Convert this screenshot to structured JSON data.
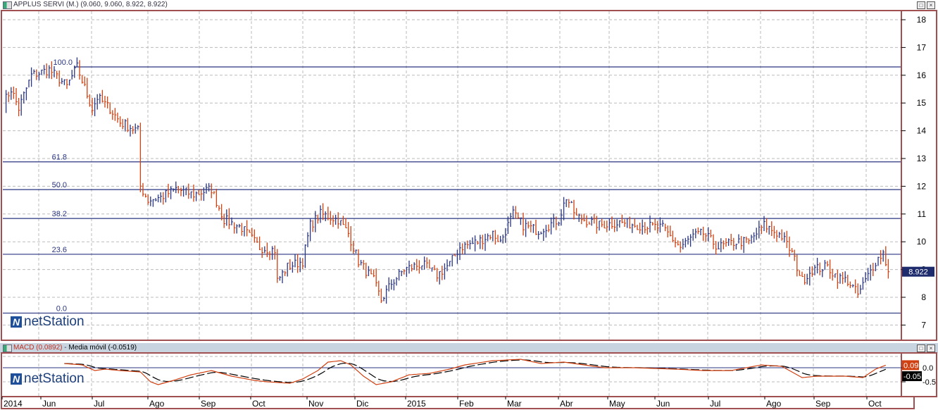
{
  "main_panel": {
    "title": "APPLUS SERVI (M.) (9.060, 9.060, 8.922, 8.922)",
    "last_price": "8.922",
    "logo": "netStation"
  },
  "macd_panel": {
    "macd_label": "MACD (0.0892)",
    "separator": "-",
    "signal_label": "Media móvil (-0.0519)",
    "macd_value": "0.09",
    "signal_value": "-0.05",
    "logo": "netStation"
  },
  "window_buttons": {
    "maximize": "□",
    "close": "×"
  },
  "chart_data": [
    {
      "type": "ohlc",
      "title": "APPLUS SERVI (M.)",
      "ylim": [
        7,
        18
      ],
      "y_ticks": [
        "18",
        "17",
        "16",
        "15",
        "14",
        "13",
        "12",
        "11",
        "10",
        "9",
        "8",
        "7"
      ],
      "x_ticks": [
        "2014",
        "Jun",
        "Jul",
        "Ago",
        "Sep",
        "Oct",
        "Nov",
        "Dic",
        "2015",
        "Feb",
        "Mar",
        "Abr",
        "May",
        "Jun",
        "Jul",
        "Ago",
        "Sep",
        "Oct"
      ],
      "fibonacci": [
        {
          "label": "100.0",
          "value": 16.3
        },
        {
          "label": "61.8",
          "value": 12.88
        },
        {
          "label": "50.0",
          "value": 11.88
        },
        {
          "label": "38.2",
          "value": 10.84
        },
        {
          "label": "23.6",
          "value": 9.55
        },
        {
          "label": "0.0",
          "value": 7.43
        }
      ],
      "close_anchors": [
        [
          0,
          15.0
        ],
        [
          3,
          15.5
        ],
        [
          6,
          14.8
        ],
        [
          11,
          16.0
        ],
        [
          18,
          16.2
        ],
        [
          25,
          15.6
        ],
        [
          29,
          16.3
        ],
        [
          35,
          14.8
        ],
        [
          37,
          15.2
        ],
        [
          42,
          14.8
        ],
        [
          46,
          14.3
        ],
        [
          53,
          14.0
        ],
        [
          54,
          12.0
        ],
        [
          57,
          11.5
        ],
        [
          62,
          11.6
        ],
        [
          68,
          11.9
        ],
        [
          75,
          11.7
        ],
        [
          82,
          11.9
        ],
        [
          87,
          10.8
        ],
        [
          94,
          10.5
        ],
        [
          101,
          9.8
        ],
        [
          107,
          9.7
        ],
        [
          108,
          8.6
        ],
        [
          112,
          9.1
        ],
        [
          118,
          9.3
        ],
        [
          121,
          10.6
        ],
        [
          125,
          11.0
        ],
        [
          132,
          10.8
        ],
        [
          136,
          10.3
        ],
        [
          140,
          9.3
        ],
        [
          146,
          8.6
        ],
        [
          149,
          7.9
        ],
        [
          153,
          8.5
        ],
        [
          158,
          9.0
        ],
        [
          165,
          9.2
        ],
        [
          171,
          8.8
        ],
        [
          176,
          9.2
        ],
        [
          180,
          9.8
        ],
        [
          187,
          10.0
        ],
        [
          193,
          10.3
        ],
        [
          196,
          10.0
        ],
        [
          201,
          11.0
        ],
        [
          205,
          10.6
        ],
        [
          211,
          10.4
        ],
        [
          219,
          10.8
        ],
        [
          222,
          11.6
        ],
        [
          226,
          10.9
        ],
        [
          235,
          10.6
        ],
        [
          243,
          10.7
        ],
        [
          251,
          10.6
        ],
        [
          260,
          10.5
        ],
        [
          267,
          9.8
        ],
        [
          272,
          10.2
        ],
        [
          276,
          10.3
        ],
        [
          282,
          9.8
        ],
        [
          289,
          10.0
        ],
        [
          294,
          10.0
        ],
        [
          300,
          10.6
        ],
        [
          307,
          10.2
        ],
        [
          311,
          9.6
        ],
        [
          315,
          8.6
        ],
        [
          319,
          9.0
        ],
        [
          325,
          9.1
        ],
        [
          329,
          8.7
        ],
        [
          333,
          8.6
        ],
        [
          337,
          8.1
        ],
        [
          340,
          8.6
        ],
        [
          344,
          9.3
        ],
        [
          347,
          9.6
        ],
        [
          349,
          8.92
        ]
      ]
    },
    {
      "type": "line",
      "title": "MACD",
      "ylim": [
        -1,
        0.5
      ],
      "y_ticks": [
        "0.0",
        "-0.5"
      ],
      "series": [
        {
          "name": "MACD",
          "color": "#d04010",
          "anchors": [
            [
              24,
              0.15
            ],
            [
              31,
              0.1
            ],
            [
              36,
              -0.1
            ],
            [
              40,
              -0.05
            ],
            [
              46,
              -0.1
            ],
            [
              54,
              -0.15
            ],
            [
              58,
              -0.5
            ],
            [
              61,
              -0.6
            ],
            [
              67,
              -0.45
            ],
            [
              74,
              -0.25
            ],
            [
              82,
              -0.1
            ],
            [
              90,
              -0.3
            ],
            [
              99,
              -0.45
            ],
            [
              104,
              -0.5
            ],
            [
              113,
              -0.55
            ],
            [
              118,
              -0.4
            ],
            [
              124,
              -0.1
            ],
            [
              128,
              0.2
            ],
            [
              133,
              0.25
            ],
            [
              137,
              0.1
            ],
            [
              142,
              -0.3
            ],
            [
              147,
              -0.6
            ],
            [
              153,
              -0.5
            ],
            [
              160,
              -0.25
            ],
            [
              168,
              -0.2
            ],
            [
              176,
              -0.05
            ],
            [
              182,
              0.1
            ],
            [
              193,
              0.25
            ],
            [
              204,
              0.3
            ],
            [
              212,
              0.15
            ],
            [
              221,
              0.2
            ],
            [
              229,
              0.1
            ],
            [
              237,
              0.0
            ],
            [
              249,
              0.0
            ],
            [
              265,
              -0.05
            ],
            [
              276,
              -0.1
            ],
            [
              287,
              -0.1
            ],
            [
              299,
              0.1
            ],
            [
              307,
              0.05
            ],
            [
              315,
              -0.35
            ],
            [
              321,
              -0.3
            ],
            [
              332,
              -0.3
            ],
            [
              339,
              -0.35
            ],
            [
              344,
              -0.05
            ],
            [
              348,
              0.09
            ]
          ]
        },
        {
          "name": "Media móvil",
          "color": "#000000",
          "smoothing": 9
        }
      ]
    }
  ]
}
